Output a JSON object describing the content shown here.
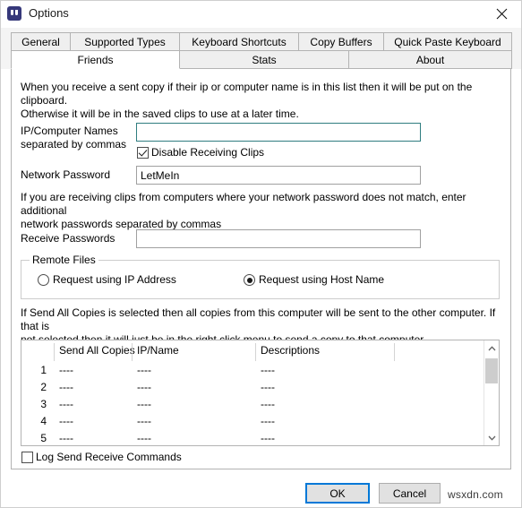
{
  "window": {
    "title": "Options",
    "icon": "quote-icon",
    "close_label": "✕"
  },
  "tabs": {
    "row1": [
      {
        "label": "General",
        "selected": false
      },
      {
        "label": "Supported Types",
        "selected": false
      },
      {
        "label": "Keyboard Shortcuts",
        "selected": false
      },
      {
        "label": "Copy Buffers",
        "selected": false
      },
      {
        "label": "Quick Paste Keyboard",
        "selected": false
      }
    ],
    "row2": [
      {
        "label": "Friends",
        "selected": true
      },
      {
        "label": "Stats",
        "selected": false
      },
      {
        "label": "About",
        "selected": false
      }
    ]
  },
  "friends": {
    "intro": "When you receive a sent copy if their ip or computer name is in this list then it will be put on the clipboard.\nOtherwise it will be in the saved clips to use at a later time.",
    "ip_names_label": "IP/Computer Names\nseparated by commas",
    "ip_names_value": "",
    "ip_names_placeholder": "",
    "disable_receiving_label": "Disable Receiving Clips",
    "disable_receiving_checked": true,
    "network_password_label": "Network Password",
    "network_password_value": "LetMeIn",
    "network_password_placeholder": "",
    "password_note": "If you are receiving clips from computers where your network password does not match, enter additional\nnetwork passwords separated by commas",
    "receive_passwords_label": "Receive Passwords",
    "receive_passwords_value": "",
    "receive_passwords_placeholder": "",
    "remote_files": {
      "title": "Remote Files",
      "options": [
        {
          "label": "Request using IP Address",
          "selected": false
        },
        {
          "label": "Request using Host Name",
          "selected": true
        }
      ]
    },
    "send_all_note": "If Send All Copies is selected then all copies from this computer will be sent to the other computer.  If that is\nnot selected then it will just be in the right click menu to send a copy to that computer.",
    "grid": {
      "columns": [
        "",
        "Send All Copies",
        "IP/Name",
        "Descriptions",
        ""
      ],
      "rows": [
        {
          "num": "1",
          "send_all": "----",
          "ip_name": "----",
          "description": "----"
        },
        {
          "num": "2",
          "send_all": "----",
          "ip_name": "----",
          "description": "----"
        },
        {
          "num": "3",
          "send_all": "----",
          "ip_name": "----",
          "description": "----"
        },
        {
          "num": "4",
          "send_all": "----",
          "ip_name": "----",
          "description": "----"
        },
        {
          "num": "5",
          "send_all": "----",
          "ip_name": "----",
          "description": "----"
        }
      ]
    },
    "log_label": "Log Send Receive Commands",
    "log_checked": false
  },
  "footer": {
    "ok_label": "OK",
    "cancel_label": "Cancel",
    "watermark": "wsxdn.com"
  },
  "colors": {
    "accent": "#0078d7",
    "focus_field_border": "#2f7d80",
    "icon_bg": "#36387a",
    "tab_bg": "#efefef",
    "panel_bg": "#ffffff"
  }
}
